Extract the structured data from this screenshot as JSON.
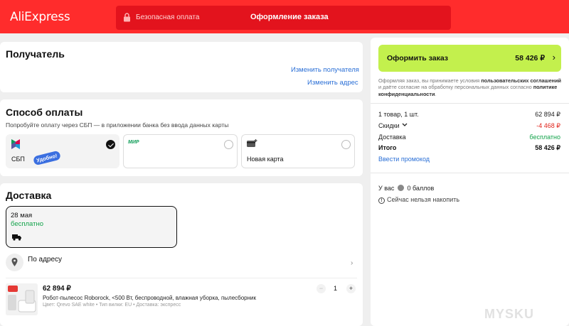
{
  "header": {
    "logo": "AliExpress",
    "secure_payment": "Безопасная оплата",
    "checkout_title": "Оформление заказа"
  },
  "recipient": {
    "title": "Получатель",
    "change_recipient": "Изменить получателя",
    "change_address": "Изменить адрес"
  },
  "payment": {
    "title": "Способ оплаты",
    "hint": "Попробуйте оплату через СБП — в приложении банка без ввода данных карты",
    "options": [
      {
        "label": "СБП",
        "badge": "Удобно!",
        "selected": true
      },
      {
        "label": "",
        "logo": "МИР",
        "selected": false
      },
      {
        "label": "Новая карта",
        "selected": false
      }
    ]
  },
  "delivery": {
    "title": "Доставка",
    "date": "28 мая",
    "price": "бесплатно",
    "address_label": "По адресу"
  },
  "product": {
    "price": "62 894 ₽",
    "name": "Робот-пылесос Roborock, <500 Вт, беспроводной, влажная уборка, пылесборник",
    "attributes": "Цвет: Qrevo SAE white • Тип вилки: EU • Доставка: экспресс",
    "quantity": "1",
    "minus": "−",
    "plus": "+"
  },
  "order": {
    "button_label": "Оформить заказ",
    "button_amount": "58 426 ₽",
    "legal_1": "Оформляя заказ, вы принимаете условия ",
    "legal_link_1": "пользовательских соглашений",
    "legal_2": " и даёте согласие на обработку персональных данных согласно ",
    "legal_link_2": "политике конфиденциальности",
    "legal_3": "."
  },
  "summary": {
    "items_label": "1 товар, 1 шт.",
    "items_value": "62 894 ₽",
    "discounts_label": "Скидки",
    "discounts_value": "-4 468 ₽",
    "delivery_label": "Доставка",
    "delivery_value": "бесплатно",
    "total_label": "Итого",
    "total_value": "58 426 ₽",
    "promo": "Ввести промокод"
  },
  "points": {
    "prefix": "У вас",
    "value": "0 баллов",
    "info": "Сейчас нельзя накопить"
  },
  "watermark": "MYSKU",
  "colors": {
    "header": "#ff2c2c",
    "accent_button": "#c3f04d",
    "link": "#2a6fd6",
    "discount": "#e0241b",
    "free": "#12a34a"
  }
}
